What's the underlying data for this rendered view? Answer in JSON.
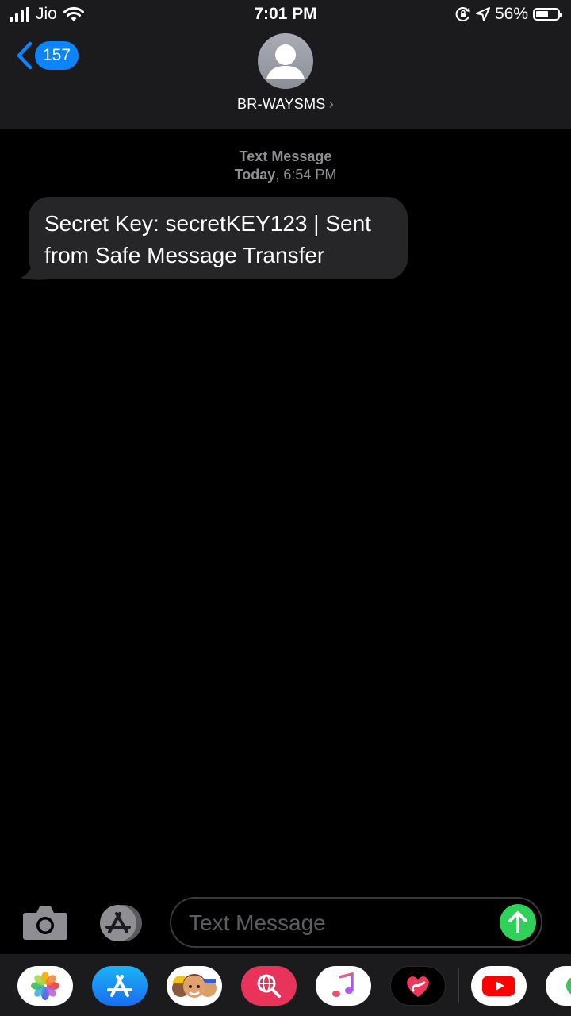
{
  "status_bar": {
    "carrier": "Jio",
    "time": "7:01 PM",
    "battery_percent": "56%",
    "battery_level": 0.56,
    "icons": [
      "signal-icon",
      "wifi-icon",
      "orientation-lock-icon",
      "location-icon",
      "battery-icon"
    ]
  },
  "nav": {
    "back_count": "157",
    "contact_name": "BR-WAYSMS",
    "chevron": "›"
  },
  "thread": {
    "service_label": "Text Message",
    "day_label": "Today",
    "time_label": ", 6:54 PM",
    "messages": [
      {
        "direction": "incoming",
        "text": "Secret Key: secretKEY123 | Sent from Safe Message Transfer"
      }
    ]
  },
  "composer": {
    "placeholder": "Text Message",
    "value": "",
    "icons": [
      "camera-icon",
      "app-store-icon",
      "send-arrow-icon"
    ],
    "colors": {
      "send": "#30d158"
    }
  },
  "app_drawer": {
    "apps": [
      "photos-app-icon",
      "app-store-app-icon",
      "memoji-app-icon",
      "web-search-app-icon",
      "music-app-icon",
      "digital-touch-app-icon",
      "youtube-app-icon",
      "more-app-icon"
    ]
  },
  "colors": {
    "accent": "#0a84ff",
    "header_bg": "#1b1b1d",
    "bubble_bg": "#262628",
    "meta_text": "#8e8e93"
  }
}
